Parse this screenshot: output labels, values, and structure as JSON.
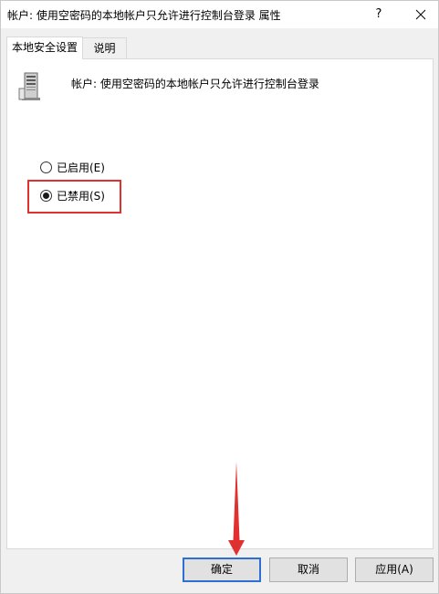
{
  "window": {
    "title": "帐户: 使用空密码的本地帐户只允许进行控制台登录 属性",
    "help_label": "?"
  },
  "tabs": [
    {
      "label": "本地安全设置",
      "active": true
    },
    {
      "label": "说明",
      "active": false
    }
  ],
  "policy": {
    "label": "帐户: 使用空密码的本地帐户只允许进行控制台登录"
  },
  "options": [
    {
      "label": "已启用(E)",
      "checked": false
    },
    {
      "label": "已禁用(S)",
      "checked": true
    }
  ],
  "buttons": {
    "ok": "确定",
    "cancel": "取消",
    "apply": "应用(A)"
  },
  "colors": {
    "highlight": "#e03030",
    "default_button_border": "#2d6fd3"
  }
}
